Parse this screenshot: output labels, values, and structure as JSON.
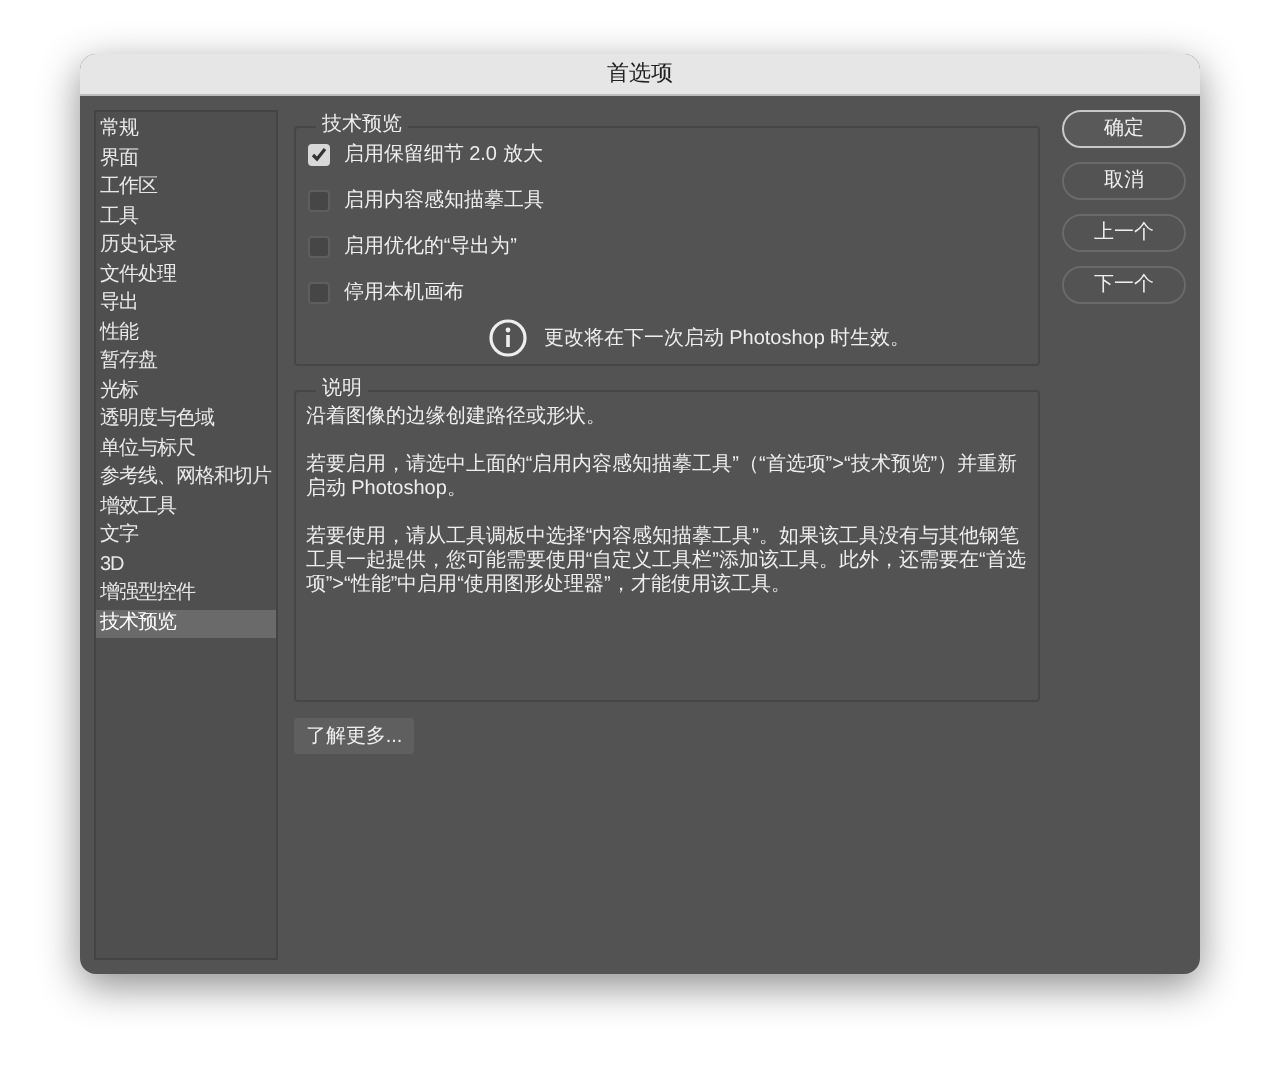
{
  "window": {
    "title": "首选项"
  },
  "sidebar": {
    "items": [
      {
        "label": "常规",
        "selected": false
      },
      {
        "label": "界面",
        "selected": false
      },
      {
        "label": "工作区",
        "selected": false
      },
      {
        "label": "工具",
        "selected": false
      },
      {
        "label": "历史记录",
        "selected": false
      },
      {
        "label": "文件处理",
        "selected": false
      },
      {
        "label": "导出",
        "selected": false
      },
      {
        "label": "性能",
        "selected": false
      },
      {
        "label": "暂存盘",
        "selected": false
      },
      {
        "label": "光标",
        "selected": false
      },
      {
        "label": "透明度与色域",
        "selected": false
      },
      {
        "label": "单位与标尺",
        "selected": false
      },
      {
        "label": "参考线、网格和切片",
        "selected": false
      },
      {
        "label": "增效工具",
        "selected": false
      },
      {
        "label": "文字",
        "selected": false
      },
      {
        "label": "3D",
        "selected": false
      },
      {
        "label": "增强型控件",
        "selected": false
      },
      {
        "label": "技术预览",
        "selected": true
      }
    ]
  },
  "tech_preview": {
    "title": "技术预览",
    "options": [
      {
        "label": "启用保留细节 2.0 放大",
        "checked": true
      },
      {
        "label": "启用内容感知描摹工具",
        "checked": false
      },
      {
        "label": "启用优化的“导出为”",
        "checked": false
      },
      {
        "label": "停用本机画布",
        "checked": false
      }
    ],
    "notice": "更改将在下一次启动 Photoshop 时生效。"
  },
  "description": {
    "title": "说明",
    "paragraphs": [
      "沿着图像的边缘创建路径或形状。",
      "若要启用，请选中上面的“启用内容感知描摹工具”（“首选项”>“技术预览”）并重新启动 Photoshop。",
      "若要使用，请从工具调板中选择“内容感知描摹工具”。如果该工具没有与其他钢笔工具一起提供，您可能需要使用“自定义工具栏”添加该工具。此外，还需要在“首选项”>“性能”中启用“使用图形处理器”，才能使用该工具。"
    ]
  },
  "learn_more_button": "了解更多...",
  "buttons": [
    {
      "label": "确定",
      "primary": true
    },
    {
      "label": "取消",
      "primary": false
    },
    {
      "label": "上一个",
      "primary": false
    },
    {
      "label": "下一个",
      "primary": false
    }
  ]
}
